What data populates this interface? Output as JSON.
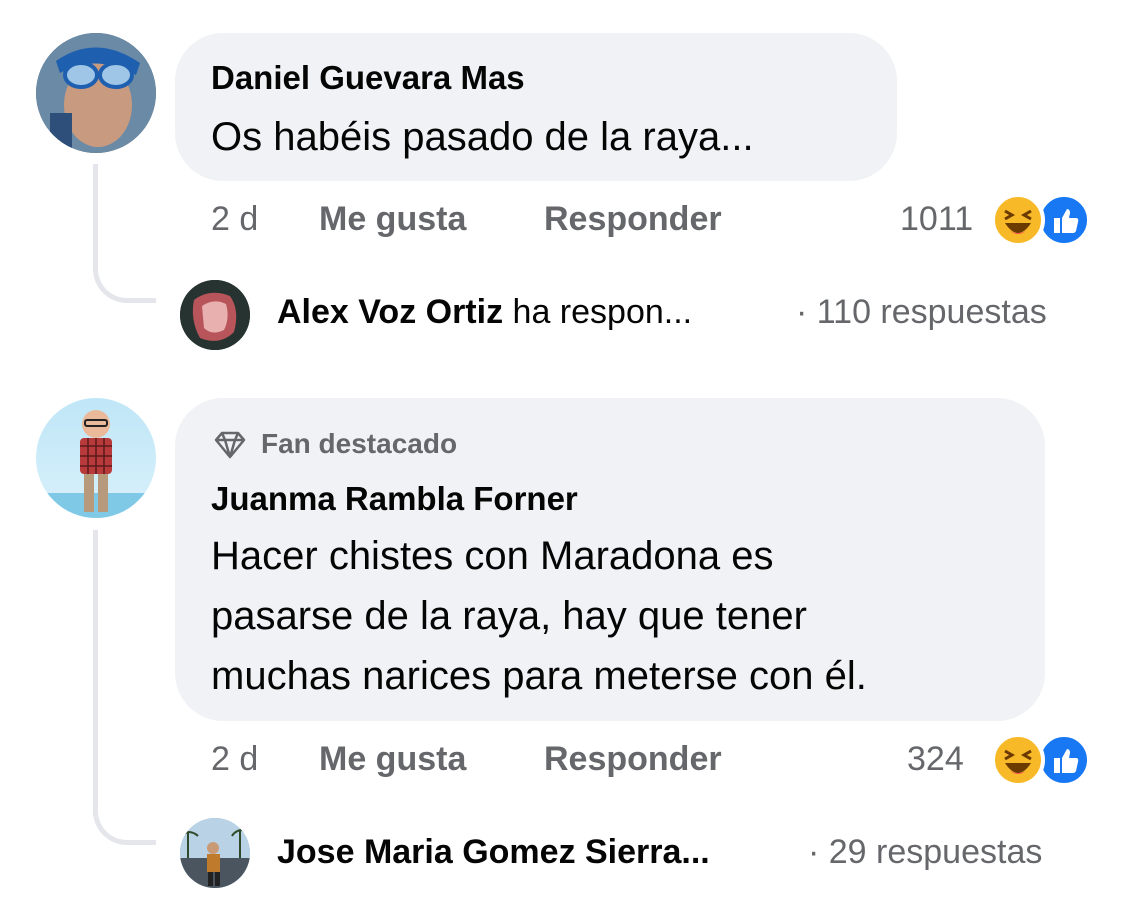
{
  "comments": [
    {
      "author": "Daniel Guevara Mas",
      "text_lines": [
        "Os habéis pasado de la raya..."
      ],
      "time": "2 d",
      "like_label": "Me gusta",
      "reply_label": "Responder",
      "reaction_count": "1011",
      "reaction_icons": [
        "haha-icon",
        "like-icon"
      ],
      "reply_preview": {
        "name": "Alex Voz Ortiz",
        "rest": " ha respon...",
        "count": "· 110 respuestas"
      }
    },
    {
      "badge": "Fan destacado",
      "author": "Juanma Rambla Forner",
      "text_lines": [
        "Hacer chistes con Maradona es",
        "pasarse de la raya, hay que tener",
        "muchas narices para meterse con él."
      ],
      "time": "2 d",
      "like_label": "Me gusta",
      "reply_label": "Responder",
      "reaction_count": "324",
      "reaction_icons": [
        "haha-icon",
        "like-icon"
      ],
      "reply_preview": {
        "name": "Jose Maria Gomez Sierra...",
        "rest": "",
        "count": "· 29 respuestas"
      }
    }
  ],
  "colors": {
    "bubble": "#f0f2f5",
    "meta_text": "#65676b",
    "like_blue": "#1877f2",
    "haha_yellow": "#f7b928"
  }
}
